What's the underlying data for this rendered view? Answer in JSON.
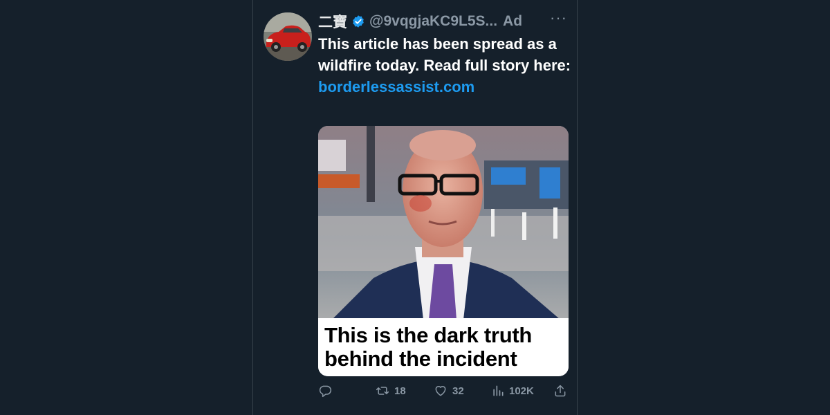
{
  "tweet": {
    "display_name": "二寶",
    "handle": "@9vqgjaKC9L5S...",
    "ad_label": "Ad",
    "more_label": "···",
    "text": "This article has been spread as a wildfire today. Read full story here:",
    "link": "borderlessassist.com",
    "media_caption": "This is the dark truth behind the incident",
    "icons": {
      "avatar": "red-car-avatar",
      "verified": "verified-badge-icon",
      "reply": "reply-icon",
      "retweet": "retweet-icon",
      "like": "heart-icon",
      "views": "views-chart-icon",
      "share": "share-icon"
    },
    "stats": {
      "reply_count": "",
      "retweet_count": "18",
      "like_count": "32",
      "view_count": "102K"
    },
    "colors": {
      "background": "#15202b",
      "link": "#1d9bf0",
      "muted": "#8b98a5",
      "verified": "#1d9bf0"
    }
  }
}
